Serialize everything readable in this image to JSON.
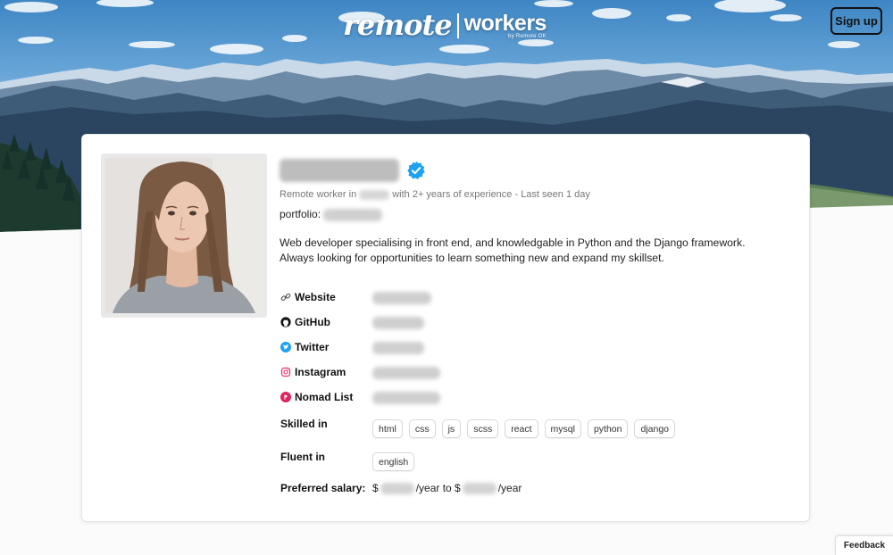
{
  "header": {
    "logo_remote": "remote",
    "logo_workers": "workers",
    "logo_by": "by Remote OK",
    "signup_label": "Sign up"
  },
  "profile": {
    "verified_icon": "verified-badge-icon",
    "subline_prefix": "Remote worker in",
    "subline_suffix": "with 2+ years of experience - Last seen 1 day",
    "portfolio_label": "portfolio:",
    "bio_line1": "Web developer specialising in front end, and knowledgable in Python and the Django framework.",
    "bio_line2": "Always looking for opportunities to learn something new and expand my skillset.",
    "links": [
      {
        "label": "Website",
        "icon": "link-icon"
      },
      {
        "label": "GitHub",
        "icon": "github-icon"
      },
      {
        "label": "Twitter",
        "icon": "twitter-icon"
      },
      {
        "label": "Instagram",
        "icon": "instagram-icon"
      },
      {
        "label": "Nomad List",
        "icon": "nomad-list-icon"
      }
    ],
    "skilled_label": "Skilled in",
    "skills": [
      "html",
      "css",
      "js",
      "scss",
      "react",
      "mysql",
      "python",
      "django"
    ],
    "fluent_label": "Fluent in",
    "languages": [
      "english"
    ],
    "salary_label": "Preferred salary:",
    "salary_currency": "$",
    "salary_mid": "/year to $",
    "salary_end": "/year"
  },
  "footer": {
    "feedback_label": "Feedback"
  },
  "colors": {
    "verified": "#1da1f2",
    "twitter": "#1da1f2",
    "instagram": "#e1306c",
    "nomad": "#e0245e",
    "card_border": "#e4e4e4"
  }
}
